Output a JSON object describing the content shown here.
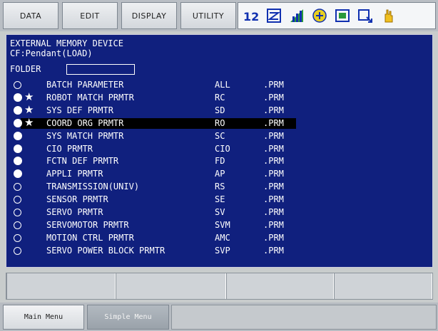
{
  "menu": {
    "data_label": "DATA",
    "edit_label": "EDIT",
    "display_label": "DISPLAY",
    "utility_label": "UTILITY"
  },
  "toolbar_icons": [
    "coordinate-icon",
    "servo-icon",
    "chart-icon",
    "tool-icon",
    "tool-frame-icon",
    "screen-icon",
    "hand-icon"
  ],
  "header": {
    "line1": "EXTERNAL MEMORY DEVICE",
    "line2": "CF:Pendant(LOAD)",
    "folder_label": "FOLDER",
    "folder_value": ""
  },
  "items": [
    {
      "mark": "open",
      "star": false,
      "name": "BATCH PARAMETER",
      "code": "ALL",
      "ext": ".PRM",
      "selected": false
    },
    {
      "mark": "filled",
      "star": true,
      "name": "ROBOT MATCH PRMTR",
      "code": "RC",
      "ext": ".PRM",
      "selected": false
    },
    {
      "mark": "filled",
      "star": true,
      "name": "SYS DEF PRMTR",
      "code": "SD",
      "ext": ".PRM",
      "selected": false
    },
    {
      "mark": "filled",
      "star": true,
      "name": "COORD ORG PRMTR",
      "code": "RO",
      "ext": ".PRM",
      "selected": true
    },
    {
      "mark": "filled",
      "star": false,
      "name": "SYS MATCH PRMTR",
      "code": "SC",
      "ext": ".PRM",
      "selected": false
    },
    {
      "mark": "filled",
      "star": false,
      "name": "CIO PRMTR",
      "code": "CIO",
      "ext": ".PRM",
      "selected": false
    },
    {
      "mark": "filled",
      "star": false,
      "name": "FCTN DEF PRMTR",
      "code": "FD",
      "ext": ".PRM",
      "selected": false
    },
    {
      "mark": "filled",
      "star": false,
      "name": "APPLI PRMTR",
      "code": "AP",
      "ext": ".PRM",
      "selected": false
    },
    {
      "mark": "open",
      "star": false,
      "name": "TRANSMISSION(UNIV)",
      "code": "RS",
      "ext": ".PRM",
      "selected": false
    },
    {
      "mark": "open",
      "star": false,
      "name": "SENSOR PRMTR",
      "code": "SE",
      "ext": ".PRM",
      "selected": false
    },
    {
      "mark": "open",
      "star": false,
      "name": "SERVO PRMTR",
      "code": "SV",
      "ext": ".PRM",
      "selected": false
    },
    {
      "mark": "open",
      "star": false,
      "name": "SERVOMOTOR PRMTR",
      "code": "SVM",
      "ext": ".PRM",
      "selected": false
    },
    {
      "mark": "open",
      "star": false,
      "name": "MOTION CTRL PRMTR",
      "code": "AMC",
      "ext": ".PRM",
      "selected": false
    },
    {
      "mark": "open",
      "star": false,
      "name": "SERVO POWER BLOCK PRMTR",
      "code": "SVP",
      "ext": ".PRM",
      "selected": false
    }
  ],
  "bottom": {
    "main_menu_label": "Main Menu",
    "simple_menu_label": "Simple Menu"
  },
  "colors": {
    "screen_bg": "#10207e",
    "text": "#ffffff",
    "selection": "#000000"
  }
}
